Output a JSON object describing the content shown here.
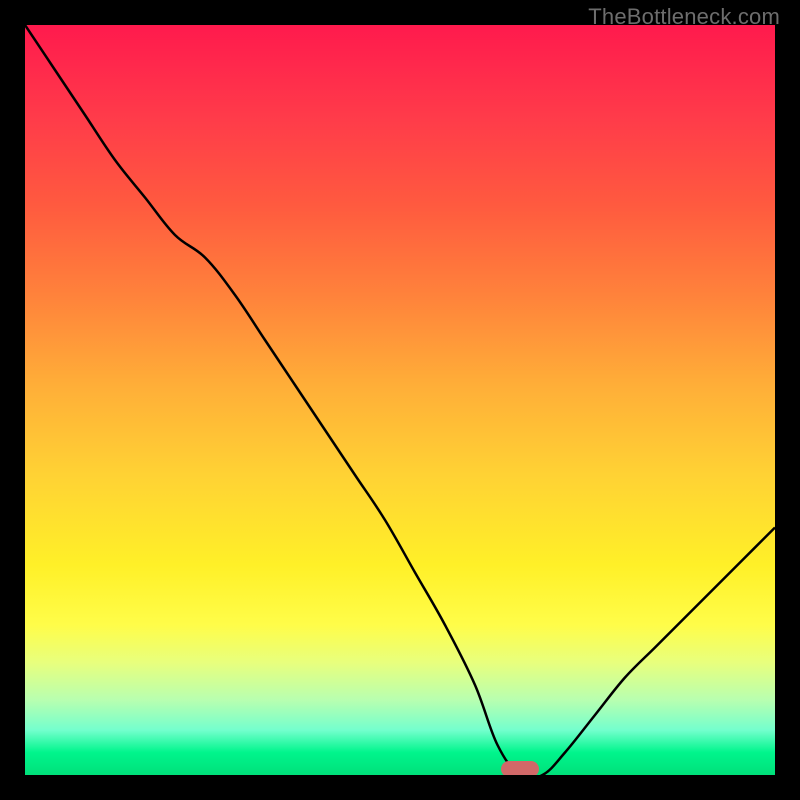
{
  "watermark": "TheBottleneck.com",
  "chart_data": {
    "type": "line",
    "title": "",
    "xlabel": "",
    "ylabel": "",
    "xlim": [
      0,
      100
    ],
    "ylim": [
      0,
      100
    ],
    "grid": false,
    "legend": false,
    "background_gradient": {
      "top": "#ff1a4d",
      "middle": "#ffd234",
      "bottom": "#00e07a"
    },
    "annotations": [
      {
        "name": "min-marker",
        "x": 66,
        "y": 0,
        "color": "#d16868"
      }
    ],
    "series": [
      {
        "name": "bottleneck-curve",
        "color": "#000000",
        "x": [
          0,
          4,
          8,
          12,
          16,
          20,
          24,
          28,
          32,
          36,
          40,
          44,
          48,
          52,
          56,
          60,
          63,
          66,
          69,
          72,
          76,
          80,
          84,
          88,
          92,
          96,
          100
        ],
        "y": [
          100,
          94,
          88,
          82,
          77,
          72,
          69,
          64,
          58,
          52,
          46,
          40,
          34,
          27,
          20,
          12,
          4,
          0,
          0,
          3,
          8,
          13,
          17,
          21,
          25,
          29,
          33
        ]
      }
    ]
  },
  "min_marker": {
    "color": "#d16868",
    "x_fraction": 0.66,
    "y_fraction": 0.992
  }
}
